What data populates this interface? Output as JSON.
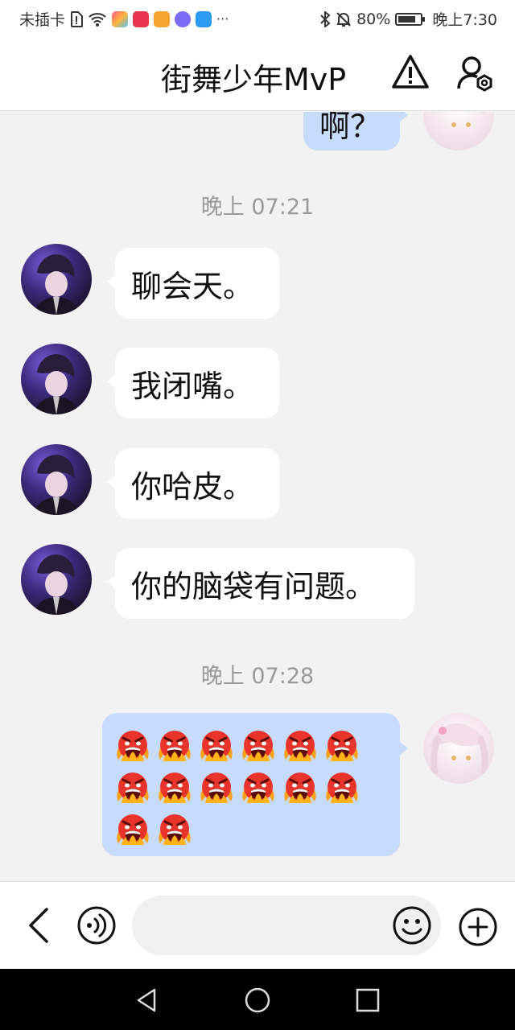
{
  "status_bar": {
    "carrier": "未插卡",
    "battery": "80%",
    "battery_level": 0.8,
    "time": "晚上7:30",
    "more_glyph": "···",
    "icons": [
      "sim-alert-icon",
      "wifi-icon",
      "app-icon",
      "huawei-app-icon",
      "app-icon",
      "music-icon",
      "weather-icon",
      "bluetooth-icon",
      "mute-icon",
      "battery-icon"
    ]
  },
  "header": {
    "title": "街舞少年MvP",
    "icons": [
      "warning-icon",
      "group-settings-icon"
    ]
  },
  "messages": [
    {
      "type": "out-partial",
      "text": "啊？"
    },
    {
      "type": "time",
      "text": "晚上 07:21"
    },
    {
      "type": "in",
      "text": "聊会天。"
    },
    {
      "type": "in",
      "text": "我闭嘴。"
    },
    {
      "type": "in",
      "text": "你哈皮。"
    },
    {
      "type": "in",
      "text": "你的脑袋有问题。"
    },
    {
      "type": "time",
      "text": "晚上 07:28"
    },
    {
      "type": "out-emoji",
      "emoji_name": "angry-fire-emoji",
      "count": 14
    }
  ],
  "input_bar": {
    "placeholder": "",
    "icons": [
      "back-icon",
      "voice-icon",
      "emoji-icon",
      "add-icon"
    ]
  },
  "nav_bar": {
    "icons": [
      "nav-back-icon",
      "nav-home-icon",
      "nav-recents-icon"
    ]
  },
  "colors": {
    "background": "#f2f2f2",
    "incoming_bubble": "#ffffff",
    "outgoing_bubble": "#c7dcfb",
    "timestamp": "#999999",
    "nav_bar": "#000000"
  }
}
